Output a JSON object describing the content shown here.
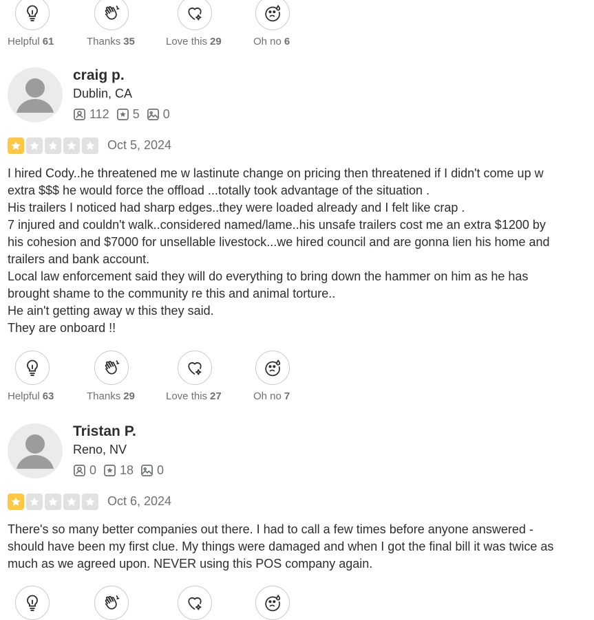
{
  "colors": {
    "star_filled": "#fec843",
    "star_empty": "#e1e1e1",
    "text": "#2d2e2f",
    "muted": "#6e7072"
  },
  "reactions_top": [
    {
      "label": "Helpful",
      "count": "61",
      "icon": "lightbulb-icon"
    },
    {
      "label": "Thanks",
      "count": "35",
      "icon": "waving-hand-icon"
    },
    {
      "label": "Love this",
      "count": "29",
      "icon": "heart-sparkle-icon"
    },
    {
      "label": "Oh no",
      "count": "6",
      "icon": "sad-face-icon"
    }
  ],
  "reviews": [
    {
      "name": "craig p.",
      "location": "Dublin, CA",
      "friends": "112",
      "reviews_count": "5",
      "photos": "0",
      "rating": 1,
      "date": "Oct 5, 2024",
      "lines": [
        "I hired Cody..he threatened me w lastinute change on pricing then threatened if I didn't come up w",
        "extra $$$ he would force the offload ...totally took advantage of the situation .",
        "His trailers I noticed had sharp edges..they were loaded already and I felt like crap .",
        "7 injured and couldn't walk..considered named/lame..his unsafe trailers cost me an extra $1200 by",
        "his cohesion and $7000 for unsellable livestock...we hired council and are gonna lien his home and",
        "trailers and bank account.",
        "Local law enforcement said they will do everything to bring down the hammer on him as he has",
        "brought shame to the community re this and animal torture..",
        "He ain't getting away w this they said.",
        "They are onboard !!"
      ],
      "reactions": [
        {
          "label": "Helpful",
          "count": "63"
        },
        {
          "label": "Thanks",
          "count": "29"
        },
        {
          "label": "Love this",
          "count": "27"
        },
        {
          "label": "Oh no",
          "count": "7"
        }
      ]
    },
    {
      "name": "Tristan P.",
      "location": "Reno, NV",
      "friends": "0",
      "reviews_count": "18",
      "photos": "0",
      "rating": 1,
      "date": "Oct 6, 2024",
      "lines": [
        "There's so many better companies out there. I had to call a few times before anyone answered -",
        "should have been my first clue. My things were damaged and when I got the final bill it was twice as",
        "much as we agreed upon. NEVER using this POS company again."
      ]
    }
  ]
}
